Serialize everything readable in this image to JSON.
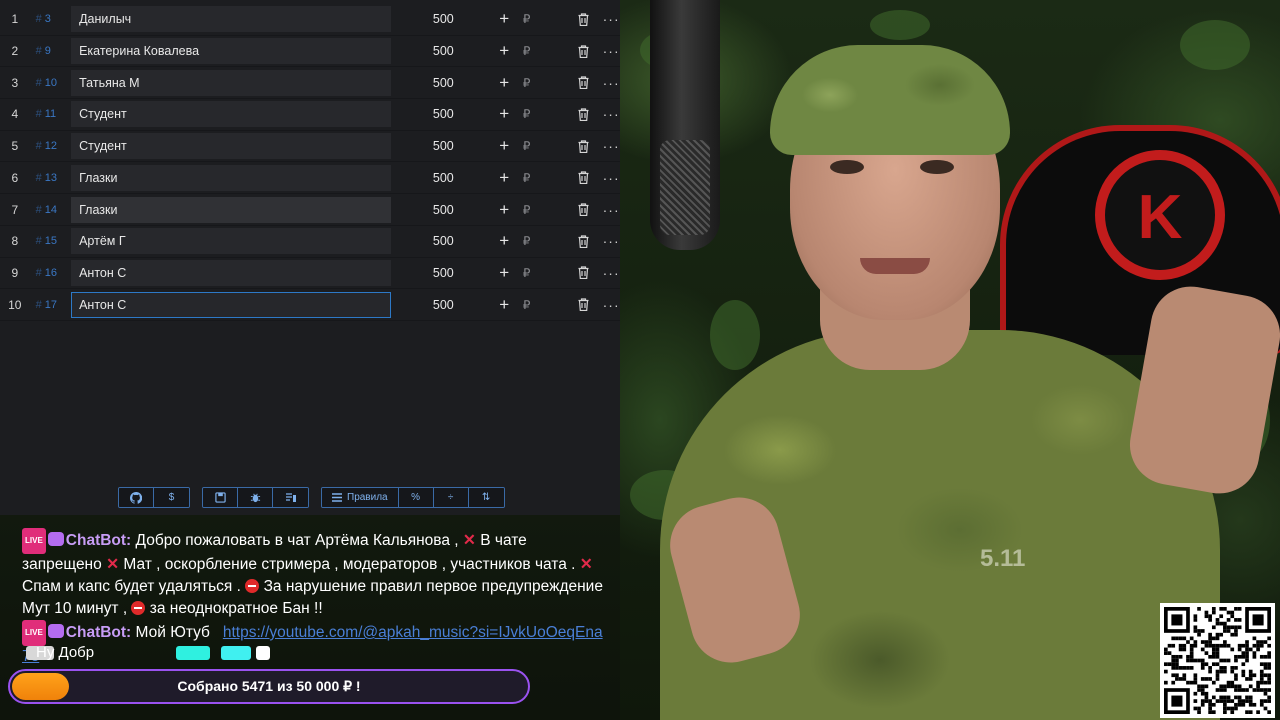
{
  "table": {
    "rows": [
      {
        "n": "1",
        "id": "3",
        "name": "Данилыч",
        "amount": "500"
      },
      {
        "n": "2",
        "id": "9",
        "name": "Екатерина Ковалева",
        "amount": "500"
      },
      {
        "n": "3",
        "id": "10",
        "name": "Татьяна М",
        "amount": "500"
      },
      {
        "n": "4",
        "id": "11",
        "name": "Студент",
        "amount": "500"
      },
      {
        "n": "5",
        "id": "12",
        "name": "Студент",
        "amount": "500"
      },
      {
        "n": "6",
        "id": "13",
        "name": "Глазки",
        "amount": "500"
      },
      {
        "n": "7",
        "id": "14",
        "name": "Глазки",
        "amount": "500"
      },
      {
        "n": "8",
        "id": "15",
        "name": "Артём Г",
        "amount": "500"
      },
      {
        "n": "9",
        "id": "16",
        "name": "Антон С",
        "amount": "500"
      },
      {
        "n": "10",
        "id": "17",
        "name": "Антон С",
        "amount": "500"
      }
    ],
    "hash_symbol": "#",
    "plus_label": "+",
    "currency": "₽",
    "more_label": "···"
  },
  "toolbar": {
    "github_icon": "github-icon",
    "dollar_label": "$",
    "rules_label": "Правила",
    "percent_label": "%",
    "split_label": "÷",
    "sort_label": "⇅"
  },
  "chat": {
    "live_badge": "LIVE",
    "msg1": {
      "author": "ChatBot:",
      "parts": [
        "Добро пожаловать в чат Артёма Кальянова ,",
        "В чате запрещено",
        "Мат , оскорбление стримера , модераторов , участников чата .",
        "Спам и капс будет удаляться .",
        "За нарушение правил первое предупреждение Мут 10 минут ,",
        "за неоднократное Бан !!"
      ],
      "x_symbol": "✕"
    },
    "msg2": {
      "author": "ChatBot:",
      "text": "Мой Ютуб",
      "link": "https://youtube.com/@apkah_music?si=IJvkUoOeqEna7e"
    },
    "partial": "Ну Добр"
  },
  "goal": {
    "text": "Собрано 5471  из 50 000 ₽ !",
    "progress_fraction": 0.11,
    "accent": "#9a52f0",
    "fill": "#f0820a"
  },
  "colors": {
    "id_blue": "#3a77c4",
    "bot_purple": "#c79cf5",
    "chair_red": "#c21c1c"
  },
  "webcam": {
    "chair_logo": "K",
    "shirt_logo": "5.11"
  }
}
